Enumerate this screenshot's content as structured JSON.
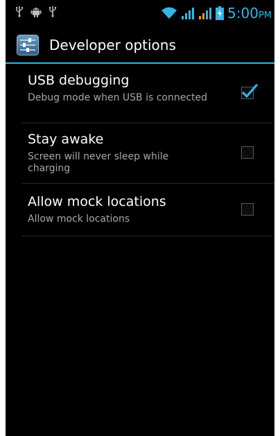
{
  "status_bar": {
    "left_icons": [
      "usb-icon",
      "android-debug-icon",
      "usb-icon"
    ],
    "right_icons": [
      "wifi-icon",
      "signal-icon",
      "signal-icon",
      "battery-charging-icon"
    ],
    "time": "5:00",
    "ampm": "PM",
    "accent_color": "#33b5e5"
  },
  "action_bar": {
    "icon": "settings-sliders-icon",
    "title": "Developer options"
  },
  "preferences": [
    {
      "title": "USB debugging",
      "summary": "Debug mode when USB is connected",
      "checked": true
    },
    {
      "title": "Stay awake",
      "summary": "Screen will never sleep while charging",
      "checked": false
    },
    {
      "title": "Allow mock locations",
      "summary": "Allow mock locations",
      "checked": false
    }
  ]
}
